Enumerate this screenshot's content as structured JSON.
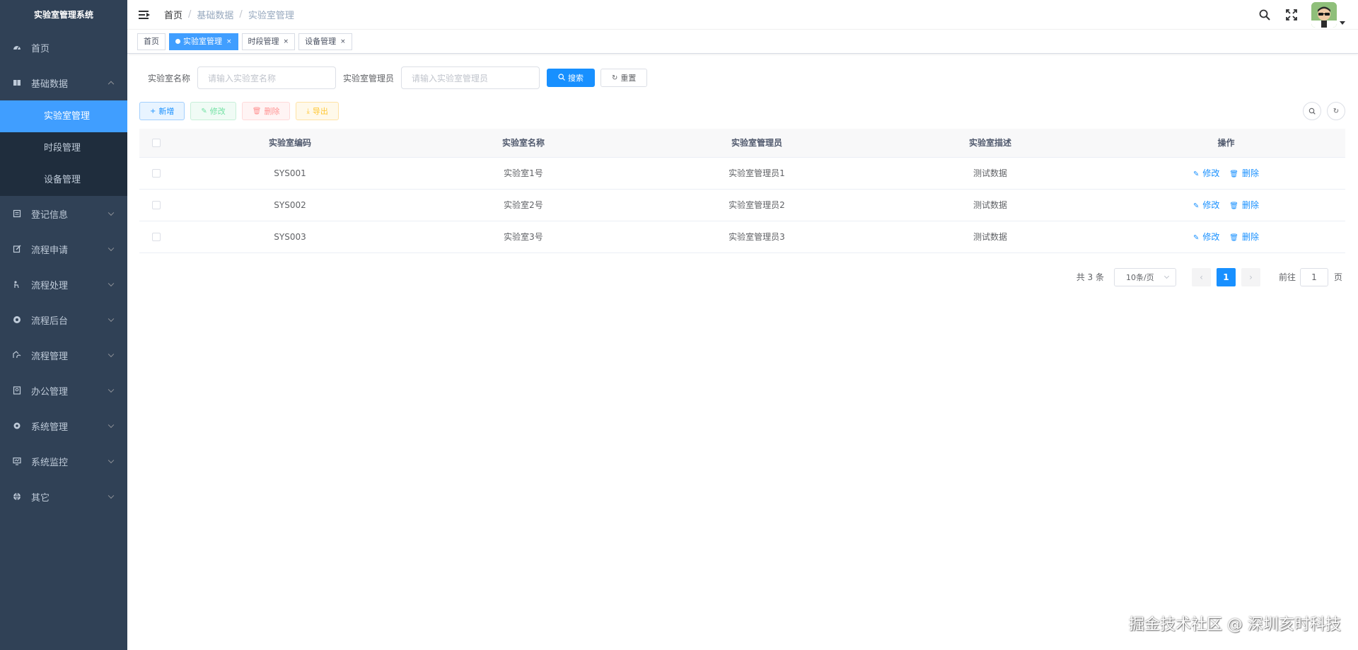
{
  "sidebar": {
    "title": "实验室管理系统",
    "items": [
      {
        "label": "首页",
        "icon": "dashboard-icon",
        "expandable": false
      },
      {
        "label": "基础数据",
        "icon": "book-icon",
        "expandable": true,
        "expanded": true,
        "children": [
          {
            "label": "实验室管理",
            "active": true
          },
          {
            "label": "时段管理",
            "active": false
          },
          {
            "label": "设备管理",
            "active": false
          }
        ]
      },
      {
        "label": "登记信息",
        "icon": "register-icon",
        "expandable": true
      },
      {
        "label": "流程申请",
        "icon": "edit-icon",
        "expandable": true
      },
      {
        "label": "流程处理",
        "icon": "process-icon",
        "expandable": true
      },
      {
        "label": "流程后台",
        "icon": "lifebuoy-icon",
        "expandable": true
      },
      {
        "label": "流程管理",
        "icon": "flow-icon",
        "expandable": true
      },
      {
        "label": "办公管理",
        "icon": "office-icon",
        "expandable": true
      },
      {
        "label": "系统管理",
        "icon": "settings-icon",
        "expandable": true
      },
      {
        "label": "系统监控",
        "icon": "monitor-icon",
        "expandable": true
      },
      {
        "label": "其它",
        "icon": "globe-icon",
        "expandable": true
      }
    ]
  },
  "breadcrumb": [
    "首页",
    "基础数据",
    "实验室管理"
  ],
  "tags": [
    {
      "label": "首页",
      "active": false,
      "closable": false
    },
    {
      "label": "实验室管理",
      "active": true,
      "closable": true
    },
    {
      "label": "时段管理",
      "active": false,
      "closable": true
    },
    {
      "label": "设备管理",
      "active": false,
      "closable": true
    }
  ],
  "search": {
    "name_label": "实验室名称",
    "name_placeholder": "请输入实验室名称",
    "admin_label": "实验室管理员",
    "admin_placeholder": "请输入实验室管理员",
    "search_button": "搜索",
    "reset_button": "重置"
  },
  "toolbar": {
    "add": "新增",
    "edit": "修改",
    "delete": "删除",
    "export": "导出"
  },
  "table": {
    "columns": [
      "实验室编码",
      "实验室名称",
      "实验室管理员",
      "实验室描述",
      "操作"
    ],
    "rows": [
      {
        "code": "SYS001",
        "name": "实验室1号",
        "admin": "实验室管理员1",
        "desc": "测试数据"
      },
      {
        "code": "SYS002",
        "name": "实验室2号",
        "admin": "实验室管理员2",
        "desc": "测试数据"
      },
      {
        "code": "SYS003",
        "name": "实验室3号",
        "admin": "实验室管理员3",
        "desc": "测试数据"
      }
    ],
    "op_edit": "修改",
    "op_delete": "删除"
  },
  "pagination": {
    "total_text": "共 3 条",
    "page_size": "10条/页",
    "current_page": "1",
    "goto_label": "前往",
    "goto_value": "1",
    "page_unit": "页"
  },
  "watermark": "掘金技术社区 @ 深圳亥时科技",
  "colors": {
    "sidebar_bg": "#304156",
    "submenu_bg": "#1f2d3d",
    "accent": "#409eff",
    "primary": "#1890ff"
  }
}
